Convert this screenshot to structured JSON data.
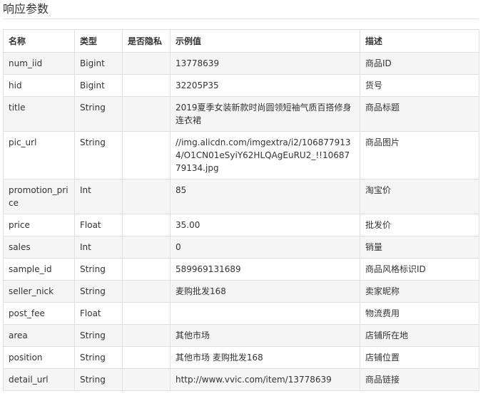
{
  "section": {
    "title": "响应参数"
  },
  "table": {
    "headers": [
      "名称",
      "类型",
      "是否隐私",
      "示例值",
      "描述"
    ],
    "rows": [
      [
        "num_iid",
        "Bigint",
        "",
        "13778639",
        "商品ID"
      ],
      [
        "hid",
        "Bigint",
        "",
        "32205P35",
        "货号"
      ],
      [
        "title",
        "String",
        "",
        "2019夏季女装新款时尚圆领短袖气质百搭修身连衣裙",
        "商品标题"
      ],
      [
        "pic_url",
        "String",
        "",
        "//img.alicdn.com/imgextra/i2/1068779134/O1CN01eSyiY62HLQAgEuRU2_!!1068779134.jpg",
        "商品图片"
      ],
      [
        "promotion_price",
        "Int",
        "",
        "85",
        "淘宝价"
      ],
      [
        "price",
        "Float",
        "",
        "35.00",
        "批发价"
      ],
      [
        "sales",
        "Int",
        "",
        "0",
        "销量"
      ],
      [
        "sample_id",
        "String",
        "",
        "589969131689",
        "商品风格标识ID"
      ],
      [
        "seller_nick",
        "String",
        "",
        "麦购批发168",
        "卖家昵称"
      ],
      [
        "post_fee",
        "Float",
        "",
        "",
        "物流费用"
      ],
      [
        "area",
        "String",
        "",
        "其他市场",
        "店铺所在地"
      ],
      [
        "position",
        "String",
        "",
        "其他市场 麦购批发168",
        "店铺位置"
      ],
      [
        "detail_url",
        "String",
        "",
        "http://www.vvic.com/item/13778639",
        "商品链接"
      ]
    ]
  }
}
